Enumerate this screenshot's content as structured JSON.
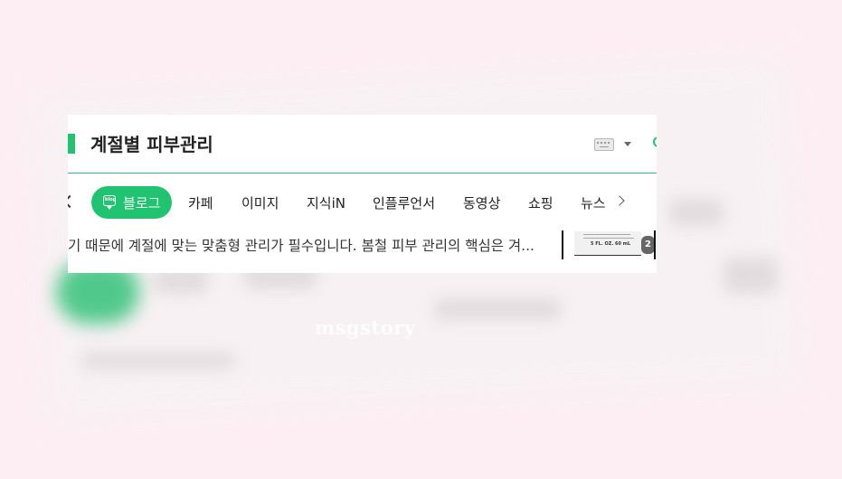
{
  "watermark": "msgstory",
  "search_result": {
    "title": "계절별 피부관리",
    "tabs": [
      {
        "label": "블로그",
        "active": true,
        "icon": "blog-icon"
      },
      {
        "label": "카페"
      },
      {
        "label": "이미지"
      },
      {
        "label": "지식iN"
      },
      {
        "label": "인플루언서"
      },
      {
        "label": "동영상"
      },
      {
        "label": "쇼핑"
      },
      {
        "label": "뉴스"
      }
    ],
    "snippet": "기 때문에 계절에 맞는 맞춤형 관리가 필수입니다. 봄철 피부 관리의 핵심은 겨...",
    "thumbnail": {
      "text": "5 FL. OZ. 60 mL",
      "count": "2"
    }
  },
  "colors": {
    "accent": "#20c370",
    "background": "#fdeef3",
    "card": "#ffffff"
  },
  "icons": [
    "keyboard-icon",
    "caret-down-icon",
    "chevron-left-icon",
    "chevron-right-icon",
    "blog-icon"
  ]
}
